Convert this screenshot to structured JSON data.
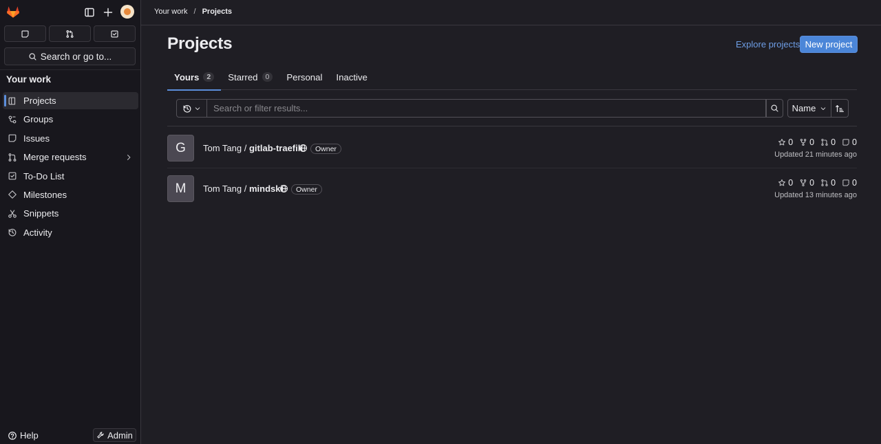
{
  "sidebar": {
    "search_label": "Search or go to...",
    "section_title": "Your work",
    "items": [
      {
        "label": "Projects",
        "icon": "project-icon",
        "active": true
      },
      {
        "label": "Groups",
        "icon": "group-icon"
      },
      {
        "label": "Issues",
        "icon": "issues-icon"
      },
      {
        "label": "Merge requests",
        "icon": "merge-request-icon",
        "has_chevron": true
      },
      {
        "label": "To-Do List",
        "icon": "todo-icon"
      },
      {
        "label": "Milestones",
        "icon": "milestone-icon"
      },
      {
        "label": "Snippets",
        "icon": "snippet-icon"
      },
      {
        "label": "Activity",
        "icon": "history-icon"
      }
    ],
    "help_label": "Help",
    "admin_label": "Admin"
  },
  "breadcrumb": {
    "parent": "Your work",
    "separator": "/",
    "current": "Projects"
  },
  "page": {
    "title": "Projects",
    "explore_label": "Explore projects",
    "new_project_label": "New project"
  },
  "tabs": [
    {
      "label": "Yours",
      "count": "2",
      "active": true
    },
    {
      "label": "Starred",
      "count": "0"
    },
    {
      "label": "Personal"
    },
    {
      "label": "Inactive"
    }
  ],
  "filter": {
    "placeholder": "Search or filter results...",
    "sort_label": "Name"
  },
  "projects": [
    {
      "initial": "G",
      "namespace": "Tom Tang / ",
      "slug": "gitlab-traefik",
      "role": "Owner",
      "stars": "0",
      "forks": "0",
      "merge_requests": "0",
      "issues": "0",
      "updated": "Updated 21 minutes ago"
    },
    {
      "initial": "M",
      "namespace": "Tom Tang / ",
      "slug": "mindski",
      "role": "Owner",
      "stars": "0",
      "forks": "0",
      "merge_requests": "0",
      "issues": "0",
      "updated": "Updated 13 minutes ago"
    }
  ],
  "colors": {
    "accent": "#5c8fdc",
    "link": "#6e9ee6",
    "primary_button": "#4b86d8",
    "sidebar_bg": "#18171d",
    "page_bg": "#1f1e24"
  }
}
